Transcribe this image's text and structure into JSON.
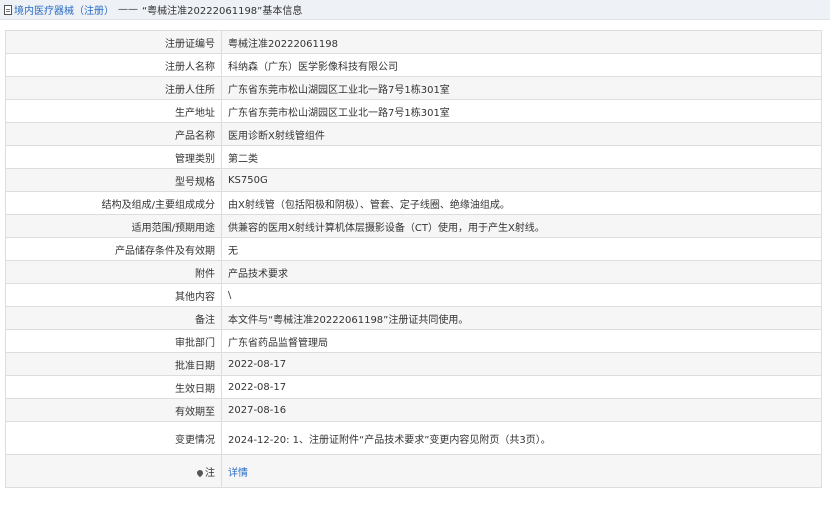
{
  "breadcrumb": {
    "section_link": "境内医疗器械（注册）",
    "separator": "——",
    "title": "“粤械注准20222061198”基本信息"
  },
  "rows": [
    {
      "label": "注册证编号",
      "value": "粤械注准20222061198"
    },
    {
      "label": "注册人名称",
      "value": "科纳森（广东）医学影像科技有限公司"
    },
    {
      "label": "注册人住所",
      "value": "广东省东莞市松山湖园区工业北一路7号1栋301室"
    },
    {
      "label": "生产地址",
      "value": "广东省东莞市松山湖园区工业北一路7号1栋301室"
    },
    {
      "label": "产品名称",
      "value": "医用诊断X射线管组件"
    },
    {
      "label": "管理类别",
      "value": "第二类"
    },
    {
      "label": "型号规格",
      "value": "KS750G"
    },
    {
      "label": "结构及组成/主要组成成分",
      "value": "由X射线管（包括阳极和阴极）、管套、定子线圈、绝缘油组成。"
    },
    {
      "label": "适用范围/预期用途",
      "value": "供兼容的医用X射线计算机体层摄影设备（CT）使用，用于产生X射线。"
    },
    {
      "label": "产品储存条件及有效期",
      "value": "无"
    },
    {
      "label": "附件",
      "value": "产品技术要求"
    },
    {
      "label": "其他内容",
      "value": "\\"
    },
    {
      "label": "备注",
      "value": "本文件与“粤械注准20222061198”注册证共同使用。"
    },
    {
      "label": "审批部门",
      "value": "广东省药品监督管理局"
    },
    {
      "label": "批准日期",
      "value": "2022-08-17"
    },
    {
      "label": "生效日期",
      "value": "2022-08-17"
    },
    {
      "label": "有效期至",
      "value": "2027-08-16"
    },
    {
      "label": "变更情况",
      "value": "2024-12-20: 1、注册证附件“产品技术要求”变更内容见附页（共3页）。"
    }
  ],
  "note_row": {
    "label": "注",
    "icon": "pin-icon",
    "link": "详情"
  }
}
